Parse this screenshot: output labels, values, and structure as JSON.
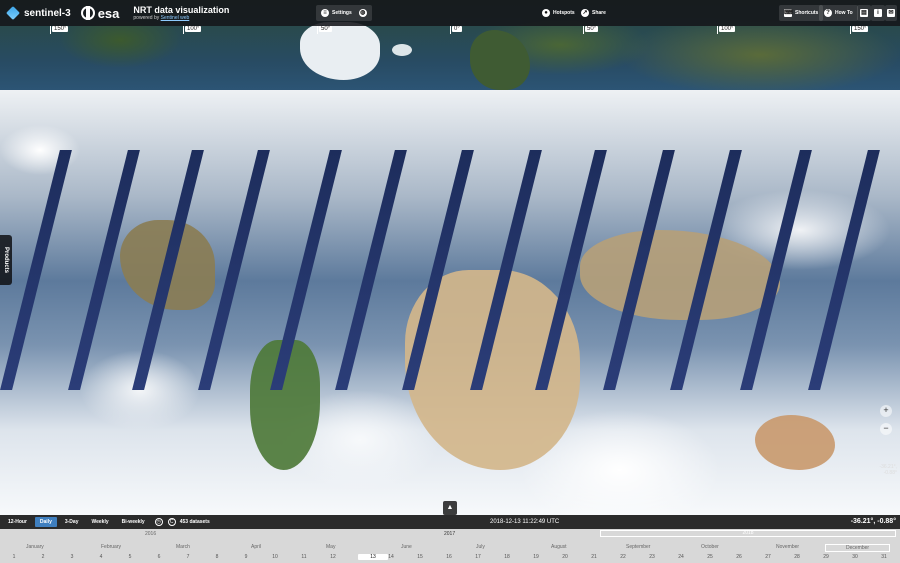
{
  "header": {
    "brand_sentinel": "sentinel-3",
    "brand_esa": "esa",
    "app_title": "NRT data visualization",
    "powered_prefix": "powered by",
    "powered_link": "Sentinel web",
    "settings_label": "Settings",
    "hotspots_label": "Hotspots",
    "share_label": "Share",
    "shortcuts_label": "Shortcuts",
    "howto_label": "How To"
  },
  "map": {
    "graticule_labels": [
      "150°",
      "100°",
      "50°",
      "0°",
      "50°",
      "100°",
      "150°"
    ]
  },
  "sidebar": {
    "products_label": "Products"
  },
  "controls": {
    "zoom_in": "+",
    "zoom_out": "−",
    "coords_small_lat": "-36.21°,",
    "coords_small_lon": "-0.88°"
  },
  "bottombar": {
    "periods": [
      "12-Hour",
      "Daily",
      "3-Day",
      "Weekly",
      "Bi-weekly"
    ],
    "active_period": "Daily",
    "dataset_count": "453 datasets",
    "current_time": "2018-12-13 11:22:49 UTC",
    "cursor_coords": "-36.21°, -0.88°"
  },
  "timeline": {
    "year_left": "2016",
    "year_center": "2017",
    "year_right": "2018",
    "months": [
      "January",
      "February",
      "March",
      "April",
      "May",
      "June",
      "July",
      "August",
      "September",
      "October",
      "November",
      "December"
    ],
    "days": [
      "1",
      "2",
      "3",
      "4",
      "5",
      "6",
      "7",
      "8",
      "9",
      "10",
      "11",
      "12",
      "13",
      "14",
      "15",
      "16",
      "17",
      "18",
      "19",
      "20",
      "21",
      "22",
      "23",
      "24",
      "25",
      "26",
      "27",
      "28",
      "29",
      "30",
      "31"
    ],
    "selected_day": "13"
  }
}
